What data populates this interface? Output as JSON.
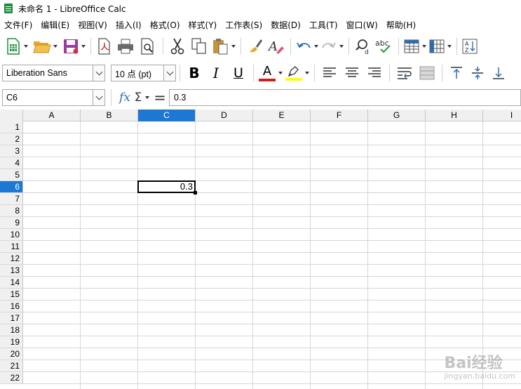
{
  "window": {
    "title": "未命名 1 - LibreOffice Calc"
  },
  "menubar": {
    "items": [
      {
        "label": "文件(F)"
      },
      {
        "label": "编辑(E)"
      },
      {
        "label": "视图(V)"
      },
      {
        "label": "插入(I)"
      },
      {
        "label": "格式(O)"
      },
      {
        "label": "样式(Y)"
      },
      {
        "label": "工作表(S)"
      },
      {
        "label": "数据(D)"
      },
      {
        "label": "工具(T)"
      },
      {
        "label": "窗口(W)"
      },
      {
        "label": "帮助(H)"
      }
    ]
  },
  "toolbar": {
    "icons": [
      "new-icon",
      "open-icon",
      "save-icon",
      "export-pdf-icon",
      "print-icon",
      "print-preview-icon",
      "cut-icon",
      "copy-icon",
      "paste-icon",
      "clone-formatting-icon",
      "clear-formatting-icon",
      "undo-icon",
      "redo-icon",
      "find-replace-icon",
      "spelling-icon",
      "row-icon",
      "column-icon",
      "sort-icon"
    ]
  },
  "format": {
    "font_name": "Liberation Sans",
    "font_size": "10 点 (pt)",
    "bold_label": "B",
    "italic_label": "I",
    "underline_label": "U",
    "font_color_label": "A",
    "font_color": "#c9211e",
    "highlight_color": "#ffff00"
  },
  "formula": {
    "name_box": "C6",
    "fx_label": "fx",
    "sum_label": "Σ",
    "equals_label": "=",
    "content": "0.3"
  },
  "sheet": {
    "columns": [
      "A",
      "B",
      "C",
      "D",
      "E",
      "F",
      "G",
      "H",
      "I"
    ],
    "rows": [
      "1",
      "2",
      "3",
      "4",
      "5",
      "6",
      "7",
      "8",
      "9",
      "10",
      "11",
      "12",
      "13",
      "14",
      "15",
      "16",
      "17",
      "18",
      "19",
      "20",
      "21",
      "22"
    ],
    "selected_column": "C",
    "selected_row": "6",
    "active_cell": {
      "ref": "C6",
      "value": "0.3"
    },
    "selection_color": "#1c78d3"
  },
  "watermark": {
    "text": "Bai经验",
    "sub": "jingyan.baidu.com"
  }
}
